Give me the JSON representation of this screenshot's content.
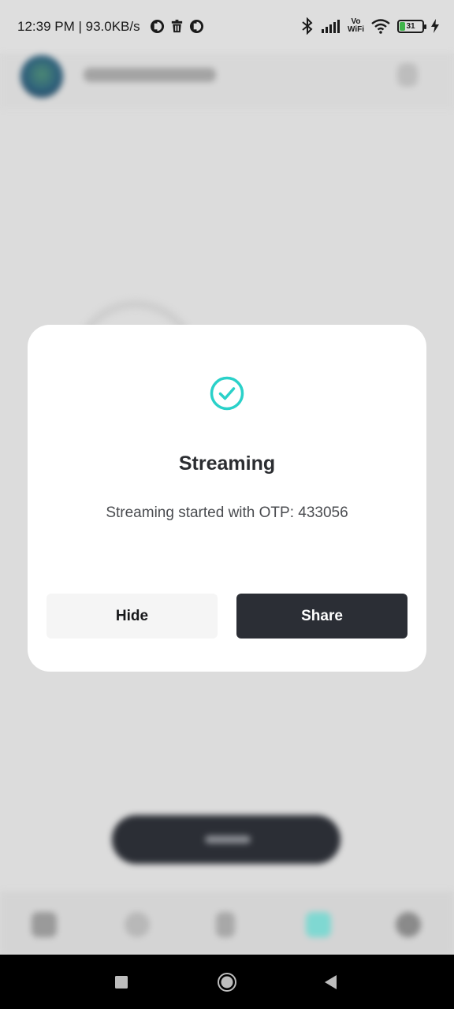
{
  "status_bar": {
    "time": "12:39 PM | 93.0KB/s",
    "vowifi_top": "Vo",
    "vowifi_bottom": "WiFi",
    "battery_percent": "31",
    "battery_level": 0.31,
    "battery_color": "#3fb44a",
    "icons": [
      "app-notification-icon",
      "trash-icon",
      "app-notification-icon",
      "bluetooth-icon",
      "signal-icon",
      "vowifi-icon",
      "wifi-icon",
      "battery-icon",
      "charging-icon"
    ]
  },
  "dialog": {
    "icon": "check-circle-icon",
    "icon_color": "#2ad1c9",
    "title": "Streaming",
    "message": "Streaming started with OTP: 433056",
    "hide_label": "Hide",
    "share_label": "Share"
  },
  "nav_bar": {
    "icons": [
      "recents-icon",
      "home-icon",
      "back-icon"
    ]
  }
}
